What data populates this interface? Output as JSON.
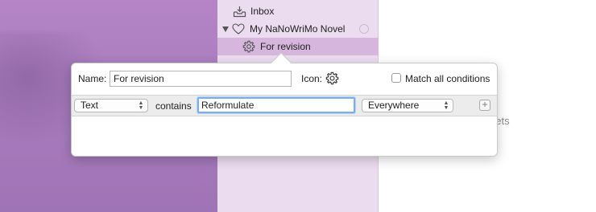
{
  "sidebar": {
    "items": [
      {
        "label": "Inbox",
        "icon": "inbox-tray-icon"
      },
      {
        "label": "My NaNoWriMo Novel",
        "icon": "heart-icon"
      },
      {
        "label": "For revision",
        "icon": "gear-icon",
        "selected": true
      }
    ]
  },
  "content": {
    "partial_text": "eets"
  },
  "popover": {
    "name_label": "Name:",
    "name_value": "For revision",
    "icon_label": "Icon:",
    "icon": "gear-icon",
    "match_all_label": "Match all conditions",
    "match_all_checked": false,
    "criteria": {
      "field_value": "Text",
      "operator_label": "contains",
      "search_value": "Reformulate",
      "scope_value": "Everywhere",
      "add_label": "+"
    }
  },
  "colors": {
    "desktop_purple": "#a97dbd",
    "sidebar_bg": "#ecdcef",
    "selection": "#d6b6dc",
    "focus_ring": "#7aaef0"
  }
}
